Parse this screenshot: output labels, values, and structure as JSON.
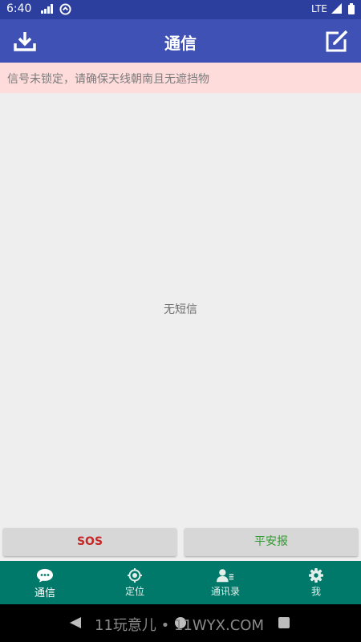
{
  "status_bar": {
    "time": "6:40",
    "network": "LTE"
  },
  "app_bar": {
    "title": "通信",
    "left_icon": "download-icon",
    "right_icon": "compose-icon"
  },
  "warning": {
    "text": "信号未锁定，请确保天线朝南且无遮挡物",
    "background": "#ffdcdc"
  },
  "content": {
    "empty_text": "无短信"
  },
  "actions": {
    "sos_label": "SOS",
    "safe_label": "平安报"
  },
  "bottom_nav": {
    "items": [
      {
        "label": "通信",
        "icon": "chat-icon",
        "active": true
      },
      {
        "label": "定位",
        "icon": "locate-icon"
      },
      {
        "label": "通讯录",
        "icon": "contacts-icon"
      },
      {
        "label": "我",
        "icon": "settings-icon"
      }
    ]
  },
  "watermark": "11玩意儿 • 11WYX.COM",
  "colors": {
    "status_bar": "#2d3f9e",
    "app_bar": "#3f51b5",
    "bottom_nav": "#00796b",
    "sos": "#c62828",
    "safe": "#2e9b2e"
  }
}
